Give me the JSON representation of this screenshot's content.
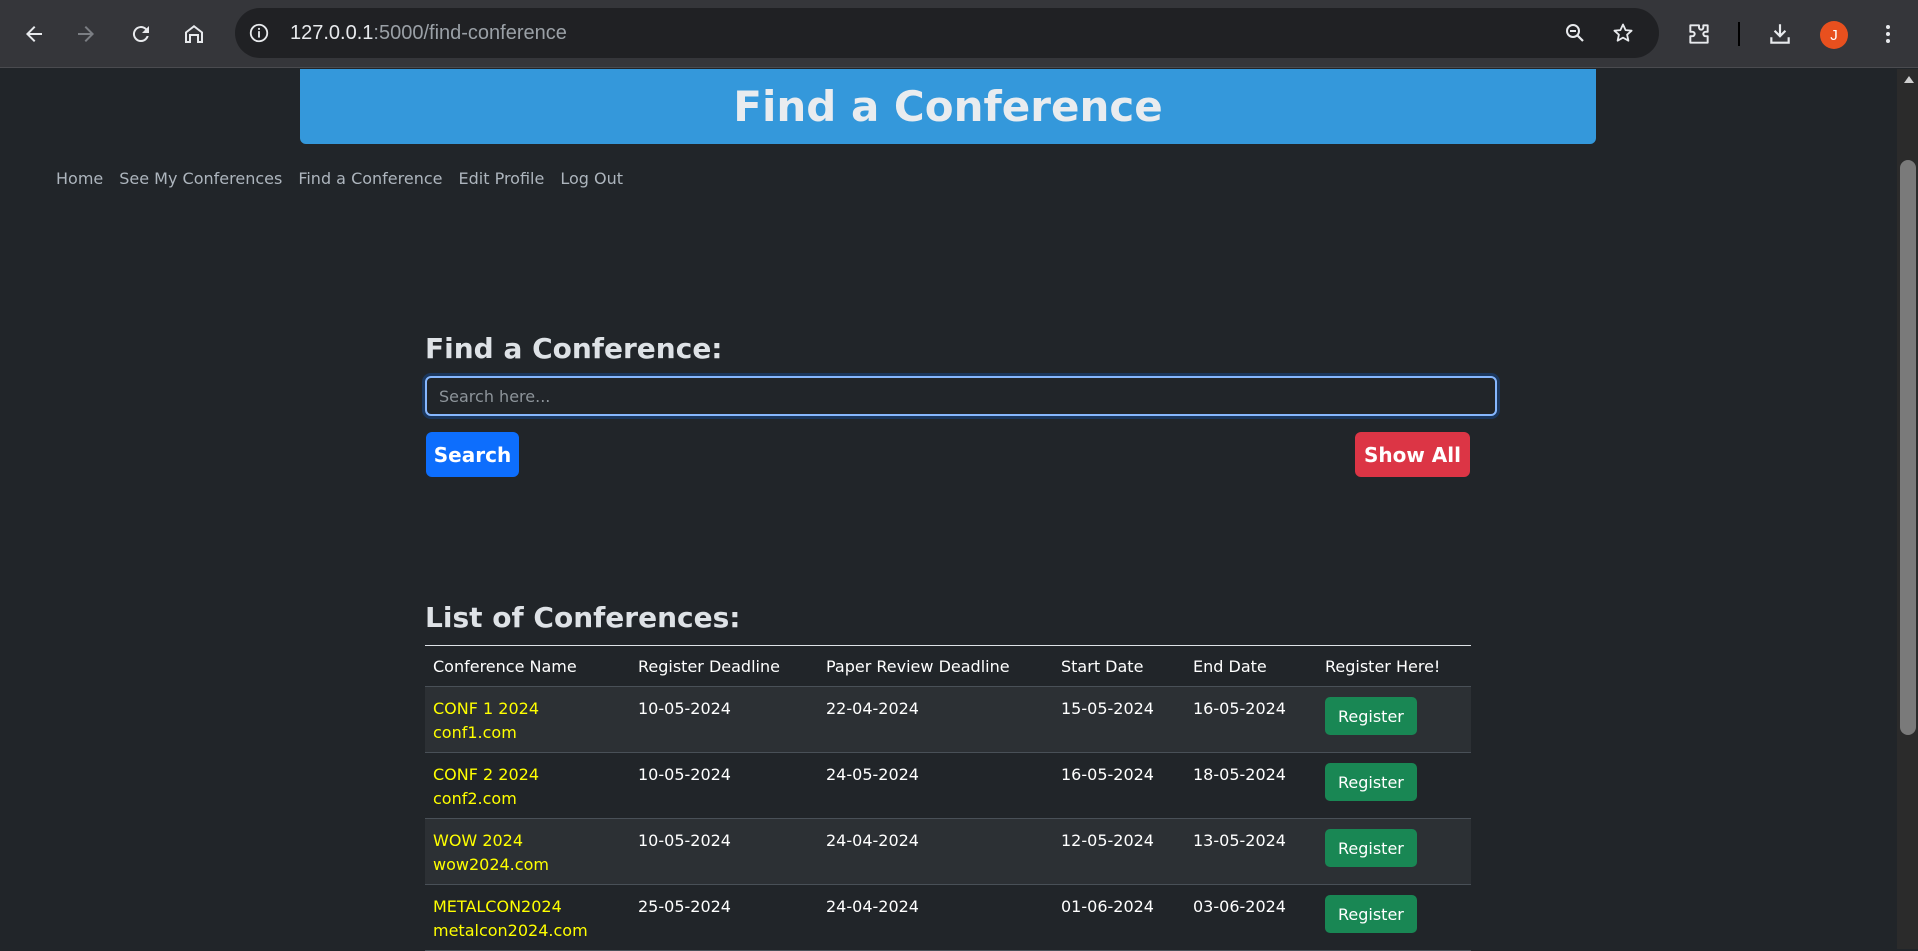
{
  "browser": {
    "url_host": "127.0.0.1",
    "url_path": ":5000/find-conference",
    "profile_initial": "J",
    "icons": [
      "back-icon",
      "forward-icon",
      "reload-icon",
      "home-icon",
      "site-info-icon",
      "zoom-icon",
      "bookmark-star-icon",
      "extensions-icon",
      "download-icon",
      "menu-icon"
    ]
  },
  "page": {
    "banner_title": "Find a Conference",
    "nav": [
      "Home",
      "See My Conferences",
      "Find a Conference",
      "Edit Profile",
      "Log Out"
    ],
    "search_heading": "Find a Conference:",
    "search_placeholder": "Search here...",
    "search_button": "Search",
    "show_all_button": "Show All",
    "list_heading": "List of Conferences:",
    "columns": [
      "Conference Name",
      "Register Deadline",
      "Paper Review Deadline",
      "Start Date",
      "End Date",
      "Register Here!"
    ],
    "rows": [
      {
        "name": "CONF 1 2024",
        "site": "conf1.com",
        "register_deadline": "10-05-2024",
        "review_deadline": "22-04-2024",
        "start": "15-05-2024",
        "end": "16-05-2024",
        "action": "Register"
      },
      {
        "name": "CONF 2 2024",
        "site": "conf2.com",
        "register_deadline": "10-05-2024",
        "review_deadline": "24-05-2024",
        "start": "16-05-2024",
        "end": "18-05-2024",
        "action": "Register"
      },
      {
        "name": "WOW 2024",
        "site": "wow2024.com",
        "register_deadline": "10-05-2024",
        "review_deadline": "24-04-2024",
        "start": "12-05-2024",
        "end": "13-05-2024",
        "action": "Register"
      },
      {
        "name": "METALCON2024",
        "site": "metalcon2024.com",
        "register_deadline": "25-05-2024",
        "review_deadline": "24-04-2024",
        "start": "01-06-2024",
        "end": "03-06-2024",
        "action": "Register"
      }
    ]
  },
  "colors": {
    "banner": "#3498db",
    "background": "#212529",
    "search_button": "#0d6efd",
    "show_all_button": "#dc3545",
    "register_button": "#198754",
    "conference_name": "#ffff00",
    "avatar": "#e8501e"
  }
}
